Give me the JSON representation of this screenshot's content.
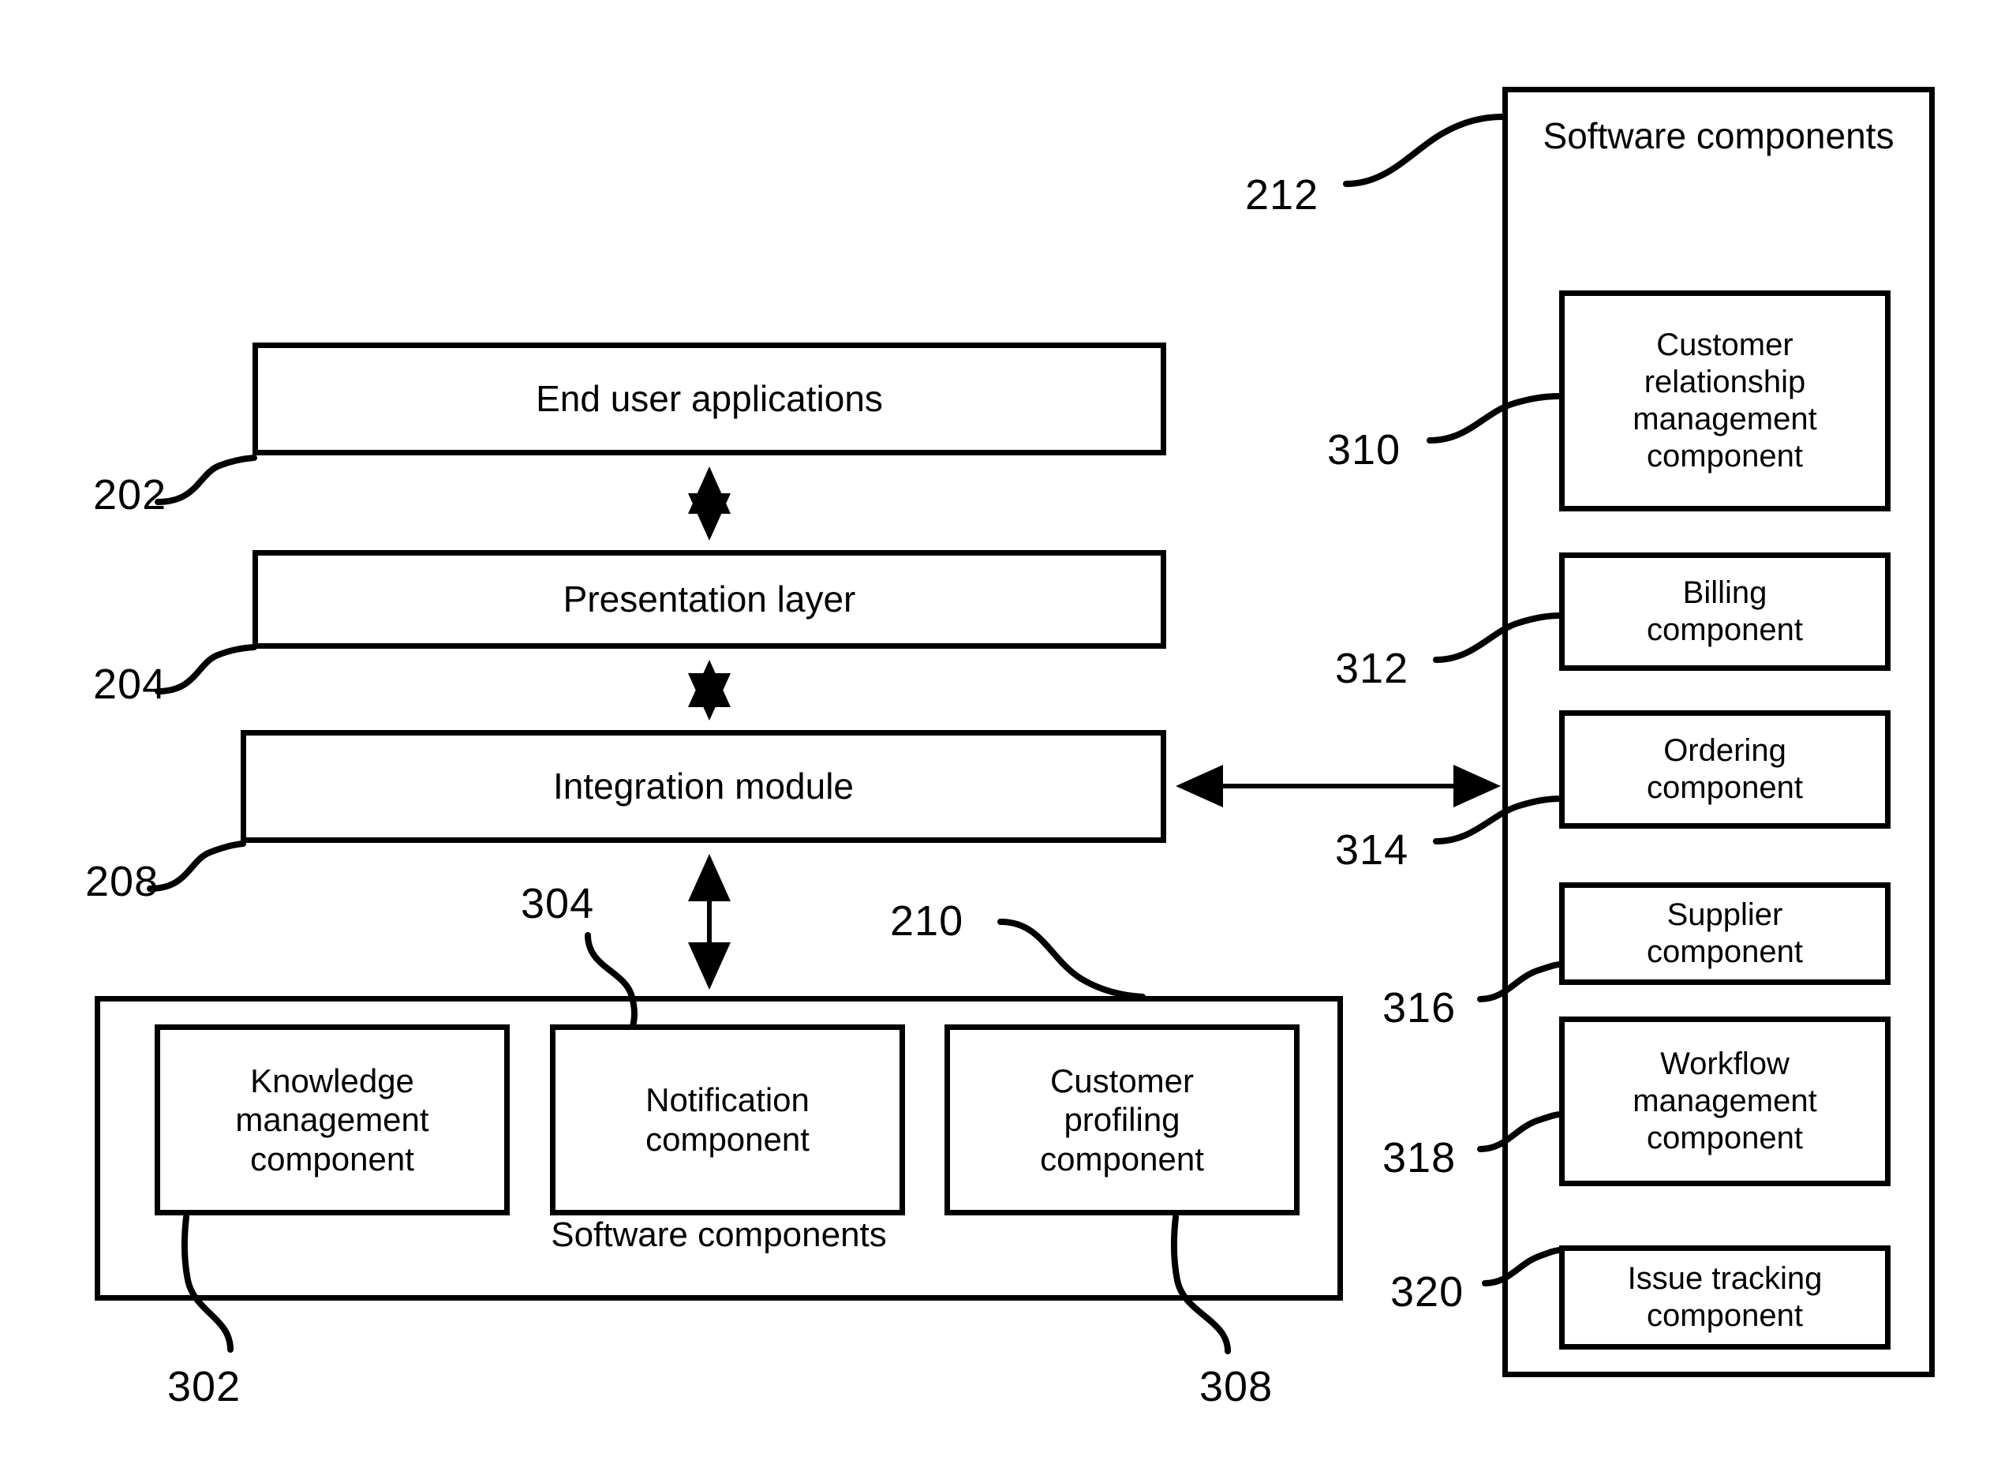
{
  "diagram": {
    "central_stack": [
      {
        "id": "end-user-applications",
        "label": "End user applications",
        "ref": "202"
      },
      {
        "id": "presentation-layer",
        "label": "Presentation layer",
        "ref": "204"
      },
      {
        "id": "integration-module",
        "label": "Integration module",
        "ref": "208"
      }
    ],
    "bottom_group": {
      "ref": "210",
      "caption": "Software components",
      "items": [
        {
          "id": "knowledge-management-component",
          "label": "Knowledge\nmanagement\ncomponent",
          "ref": "302"
        },
        {
          "id": "notification-component",
          "label": "Notification\ncomponent",
          "ref": "304"
        },
        {
          "id": "customer-profiling-component",
          "label": "Customer\nprofiling\ncomponent",
          "ref": "308"
        }
      ]
    },
    "right_panel": {
      "ref": "212",
      "caption": "Software\ncomponents",
      "items": [
        {
          "id": "customer-relationship-management-component",
          "label": "Customer\nrelationship\nmanagement\ncomponent",
          "ref": "310"
        },
        {
          "id": "billing-component",
          "label": "Billing\ncomponent",
          "ref": "312"
        },
        {
          "id": "ordering-component",
          "label": "Ordering\ncomponent",
          "ref": "314"
        },
        {
          "id": "supplier-component",
          "label": "Supplier\ncomponent",
          "ref": "316"
        },
        {
          "id": "workflow-management-component",
          "label": "Workflow\nmanagement\ncomponent",
          "ref": "318"
        },
        {
          "id": "issue-tracking-component",
          "label": "Issue tracking\ncomponent",
          "ref": "320"
        }
      ]
    },
    "refs": {
      "r202": "202",
      "r204": "204",
      "r208": "208",
      "r210": "210",
      "r212": "212",
      "r302": "302",
      "r304": "304",
      "r308": "308",
      "r310": "310",
      "r312": "312",
      "r314": "314",
      "r316": "316",
      "r318": "318",
      "r320": "320"
    },
    "colors": {
      "stroke": "#000000",
      "background": "#ffffff"
    }
  }
}
